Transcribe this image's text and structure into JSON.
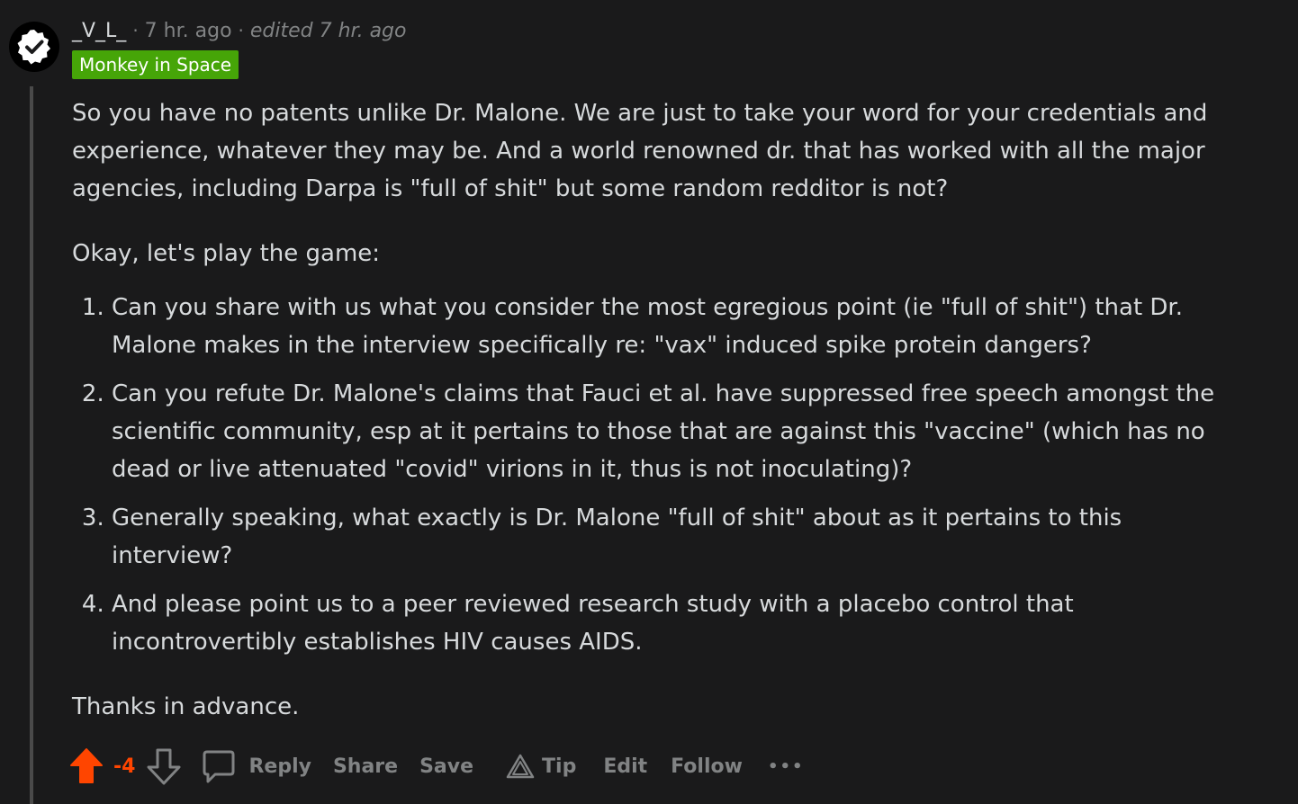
{
  "comment": {
    "author": "_V_L_",
    "separator": "·",
    "time": "7 hr. ago",
    "edited": "edited 7 hr. ago",
    "flair": "Monkey in Space",
    "paragraphs": {
      "p1": "So you have no patents unlike Dr. Malone. We are just to take your word for your credentials and experience, whatever they may be. And a world renowned dr. that has worked with all the major agencies, including Darpa is \"full of shit\" but some random redditor is not?",
      "p2": "Okay, let's play the game:",
      "p3": "Thanks in advance."
    },
    "list": [
      "Can you share with us what you consider the most egregious point (ie \"full of shit\") that Dr. Malone makes in the interview specifically re: \"vax\" induced spike protein dangers?",
      "Can you refute Dr. Malone's claims that Fauci et al. have suppressed free speech amongst the scientific community, esp at it pertains to those that are against this \"vaccine\" (which has no dead or live attenuated \"covid\" virions in it, thus is not inoculating)?",
      "Generally speaking, what exactly is Dr. Malone \"full of shit\" about as it pertains to this interview?",
      "And please point us to a peer reviewed research study with a placebo control that incontrovertibly establishes HIV causes AIDS."
    ]
  },
  "actions": {
    "score": "-4",
    "reply": "Reply",
    "share": "Share",
    "save": "Save",
    "tip": "Tip",
    "edit": "Edit",
    "follow": "Follow",
    "more": "•••"
  },
  "icons": {
    "upvote": "upvote-arrow-icon",
    "downvote": "downvote-arrow-icon",
    "reply": "comment-bubble-icon",
    "tip": "tip-triangle-icon",
    "avatar": "verified-check-icon"
  },
  "colors": {
    "background": "#1a1a1b",
    "text": "#d7dadc",
    "muted": "#818384",
    "upvote_active": "#ff4500",
    "flair_bg": "#46a508"
  }
}
